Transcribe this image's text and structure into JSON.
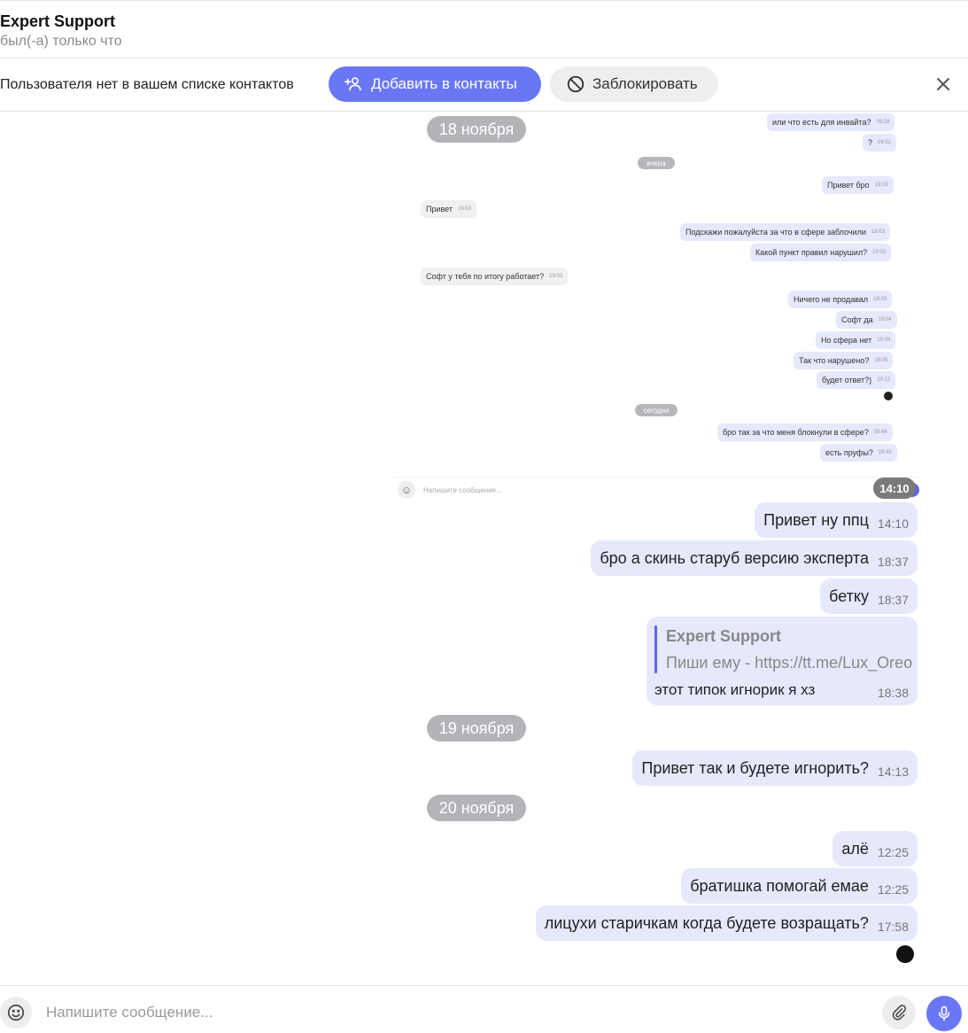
{
  "header": {
    "name": "Expert Support",
    "status": "был(-а) только что"
  },
  "contact_bar": {
    "notice": "Пользователя нет в вашем списке контактов",
    "add_label": "Добавить в контакты",
    "block_label": "Заблокировать"
  },
  "pasted": {
    "date_yesterday": "вчера",
    "date_today": "сегодня",
    "placeholder": "Напишите сообщение...",
    "overlay_time": "14:10",
    "messages": [
      {
        "text": "или что есть для инвайта?",
        "time": "09:28",
        "dir": "out"
      },
      {
        "text": "?",
        "time": "09:52",
        "dir": "out"
      },
      {
        "text": "Привет бро",
        "time": "19:03",
        "dir": "out"
      },
      {
        "text": "Привет",
        "time": "19:03",
        "dir": "in"
      },
      {
        "text": "Подскажи пожалуйста за что в сфере заблочили",
        "time": "19:03",
        "dir": "out"
      },
      {
        "text": "Какой пункт правил нарушил?",
        "time": "19:03",
        "dir": "out"
      },
      {
        "text": "Софт у тебя по итогу работает?",
        "time": "19:03",
        "dir": "in"
      },
      {
        "text": "Ничего не продавал",
        "time": "19:03",
        "dir": "out"
      },
      {
        "text": "Софт да",
        "time": "19:04",
        "dir": "out"
      },
      {
        "text": "Но сфера нет",
        "time": "19:04",
        "dir": "out"
      },
      {
        "text": "Так что нарушено?",
        "time": "19:05",
        "dir": "out"
      },
      {
        "text": "будет ответ?)",
        "time": "20:12",
        "dir": "out"
      },
      {
        "text": "бро так за что меня блокнули в сфере?",
        "time": "09:46",
        "dir": "out"
      },
      {
        "text": "есть пруфы?",
        "time": "09:46",
        "dir": "out"
      }
    ]
  },
  "dates": {
    "d18": "18 ноября",
    "d19": "19 ноября",
    "d20": "20 ноября"
  },
  "messages": [
    {
      "text": "Привет ну ппц",
      "time": "14:10"
    },
    {
      "text": "бро а скинь старуб версию эксперта",
      "time": "18:37"
    },
    {
      "text": "бетку",
      "time": "18:37"
    },
    {
      "text": "Привет так и будете игнорить?",
      "time": "14:13"
    },
    {
      "text": "алё",
      "time": "12:25"
    },
    {
      "text": "братишка помогай емае",
      "time": "12:25"
    },
    {
      "text": "лицухи старичкам когда будете возращать?",
      "time": "17:58"
    }
  ],
  "reply": {
    "author": "Expert Support",
    "quote": "Пиши ему - https://tt.me/Lux_Oreo",
    "text": "этот типок игнорик я хз",
    "time": "18:38"
  },
  "input": {
    "placeholder": "Напишите сообщение..."
  },
  "icons": {
    "add_contact": "person-plus-icon",
    "block": "block-icon",
    "close": "close-icon",
    "emoji": "smile-icon",
    "attach": "paperclip-icon",
    "mic": "microphone-icon"
  },
  "colors": {
    "accent": "#6a77f5",
    "bubble_out": "#e6e8fb",
    "date_pill": "#b4b4b8"
  }
}
